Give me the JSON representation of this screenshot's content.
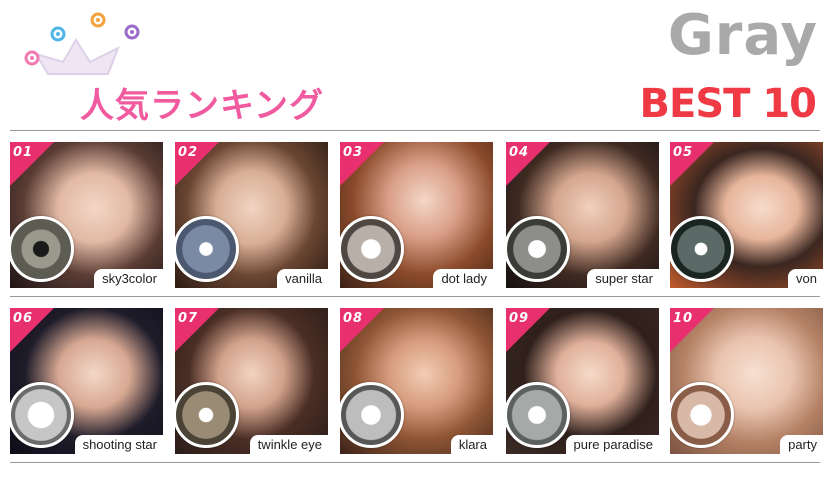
{
  "header": {
    "title_jp": "人気ランキング",
    "color_word": "Gray",
    "best_label": "BEST 10"
  },
  "colors": {
    "pink": "#f25aa0",
    "rank_tag": "#e8306e",
    "gray_word": "#a9a9a9",
    "best_red": "#ef3a45"
  },
  "rankings": [
    {
      "rank": "01",
      "name": "sky3color"
    },
    {
      "rank": "02",
      "name": "vanilla"
    },
    {
      "rank": "03",
      "name": "dot lady"
    },
    {
      "rank": "04",
      "name": "super star"
    },
    {
      "rank": "05",
      "name": "von"
    },
    {
      "rank": "06",
      "name": "shooting star"
    },
    {
      "rank": "07",
      "name": "twinkle eye"
    },
    {
      "rank": "08",
      "name": "klara"
    },
    {
      "rank": "09",
      "name": "pure paradise"
    },
    {
      "rank": "10",
      "name": "party"
    }
  ]
}
